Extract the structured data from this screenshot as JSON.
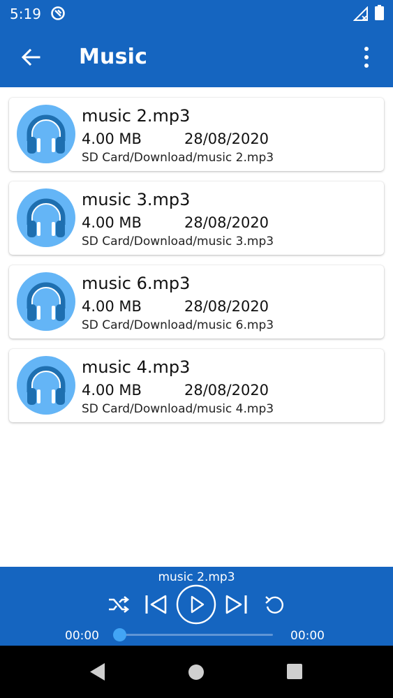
{
  "status_bar": {
    "time": "5:19",
    "icons": [
      "app-notification-icon",
      "signal-off-icon",
      "battery-icon"
    ]
  },
  "app_bar": {
    "title": "Music",
    "back_icon": "arrow-left-icon",
    "menu_icon": "more-vertical-icon"
  },
  "files": [
    {
      "name": "music 2.mp3",
      "size": "4.00 MB",
      "date": "28/08/2020",
      "path": "SD Card/Download/music 2.mp3"
    },
    {
      "name": "music 3.mp3",
      "size": "4.00 MB",
      "date": "28/08/2020",
      "path": "SD Card/Download/music 3.mp3"
    },
    {
      "name": "music 6.mp3",
      "size": "4.00 MB",
      "date": "28/08/2020",
      "path": "SD Card/Download/music 6.mp3"
    },
    {
      "name": "music 4.mp3",
      "size": "4.00 MB",
      "date": "28/08/2020",
      "path": "SD Card/Download/music 4.mp3"
    }
  ],
  "player": {
    "now_playing": "music 2.mp3",
    "elapsed": "00:00",
    "duration": "00:00",
    "progress": 0,
    "controls": [
      "shuffle-icon",
      "skip-previous-icon",
      "play-icon",
      "skip-next-icon",
      "repeat-icon"
    ]
  },
  "colors": {
    "primary": "#1565c0",
    "accent": "#42a5f5",
    "icon_circle": "#64b5f6",
    "icon_dark": "#1e6fb0"
  }
}
